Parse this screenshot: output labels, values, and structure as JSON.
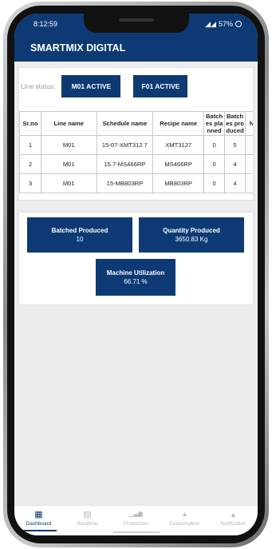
{
  "status_bar": {
    "time": "8:12:59",
    "signal": "◢◢",
    "battery": "57%"
  },
  "app": {
    "title": "SMARTMIX DIGITAL"
  },
  "line_status": {
    "label": "Line status:",
    "badges": [
      "M01 ACTIVE",
      "F01 ACTIVE"
    ]
  },
  "table": {
    "headers": [
      "Sr.no",
      "Line name",
      "Schedule name",
      "Recipe name",
      "Batch es pla nned",
      "Batch es pro duced",
      "N"
    ],
    "rows": [
      [
        "1",
        "M01",
        "15-07-XMT312 7",
        "XMT3127",
        "0",
        "5",
        ""
      ],
      [
        "2",
        "M01",
        "15.7-MS466RP",
        "MS466RP",
        "0",
        "4",
        ""
      ],
      [
        "3",
        "M01",
        "15-MB803RP",
        "MB803RP",
        "0",
        "4",
        ""
      ]
    ]
  },
  "stats": {
    "batched": {
      "title": "Batched Produced",
      "value": "10"
    },
    "quantity": {
      "title": "Quantity Produced",
      "value": "3650.83 Kg"
    },
    "utilization": {
      "title": "Machine Utilization",
      "value": "66.71 %"
    }
  },
  "nav": [
    {
      "label": "Dashboard",
      "icon": "▦",
      "icon_name": "dashboard-icon"
    },
    {
      "label": "Realtime",
      "icon": "▤",
      "icon_name": "realtime-icon"
    },
    {
      "label": "Production",
      "icon": "▁▃▆",
      "icon_name": "production-icon"
    },
    {
      "label": "Consumption",
      "icon": "▲",
      "icon_name": "consumption-icon"
    },
    {
      "label": "Notification",
      "icon": "▲",
      "icon_name": "bell-icon"
    }
  ],
  "colors": {
    "primary": "#0d3a74",
    "background": "#ececec"
  }
}
